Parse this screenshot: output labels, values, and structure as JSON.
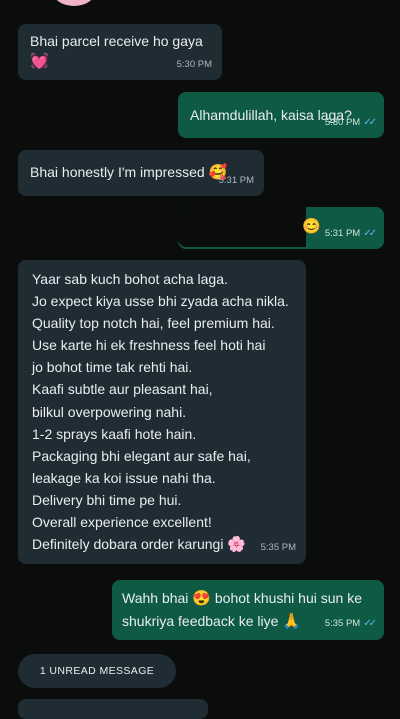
{
  "messages": [
    {
      "id": "m1",
      "dir": "in",
      "text": "Bhai parcel receive ho gaya",
      "emoji": "💓",
      "time": "5:30 PM"
    },
    {
      "id": "m2",
      "dir": "out",
      "text": "Alhamdulillah, kaisa laga?",
      "time": "5:30 PM"
    },
    {
      "id": "m3",
      "dir": "in",
      "text": "Bhai honestly I'm impressed",
      "emoji": "🥰",
      "time": "5:31 PM"
    },
    {
      "id": "m4",
      "dir": "out",
      "text": "",
      "emoji": "😊",
      "time": "5:31 PM"
    },
    {
      "id": "m5",
      "dir": "in",
      "lines": [
        "Yaar sab kuch bohot acha laga.",
        "Jo expect kiya usse bhi zyada acha nikla.",
        "Quality top notch hai, feel premium hai.",
        "Use karte hi ek freshness feel hoti hai",
        "jo bohot time tak rehti hai.",
        "Kaafi subtle aur pleasant hai,",
        "bilkul overpowering nahi.",
        "1-2 sprays kaafi hote hain.",
        "Packaging bhi elegant aur safe hai,",
        "leakage ka koi issue nahi tha.",
        "Delivery bhi time pe hui.",
        "Overall experience excellent!",
        "Definitely dobara order karungi"
      ],
      "emoji": "🌸",
      "time": "5:35 PM"
    },
    {
      "id": "m6",
      "dir": "out",
      "lines": [
        "Wahh bhai",
        "bohot khushi hui sun ke",
        "shukriya feedback ke liye"
      ],
      "emoji1": "😍",
      "emoji2": "🙏",
      "time": "5:35 PM"
    }
  ],
  "unread_label": "1 UNREAD MESSAGE",
  "colors": {
    "incoming": "#1f2c33",
    "outgoing": "#0e5a45",
    "background": "#0b0d0c",
    "read_ticks": "#53bdeb"
  },
  "icons": {
    "read_receipt": "double-check-icon"
  }
}
